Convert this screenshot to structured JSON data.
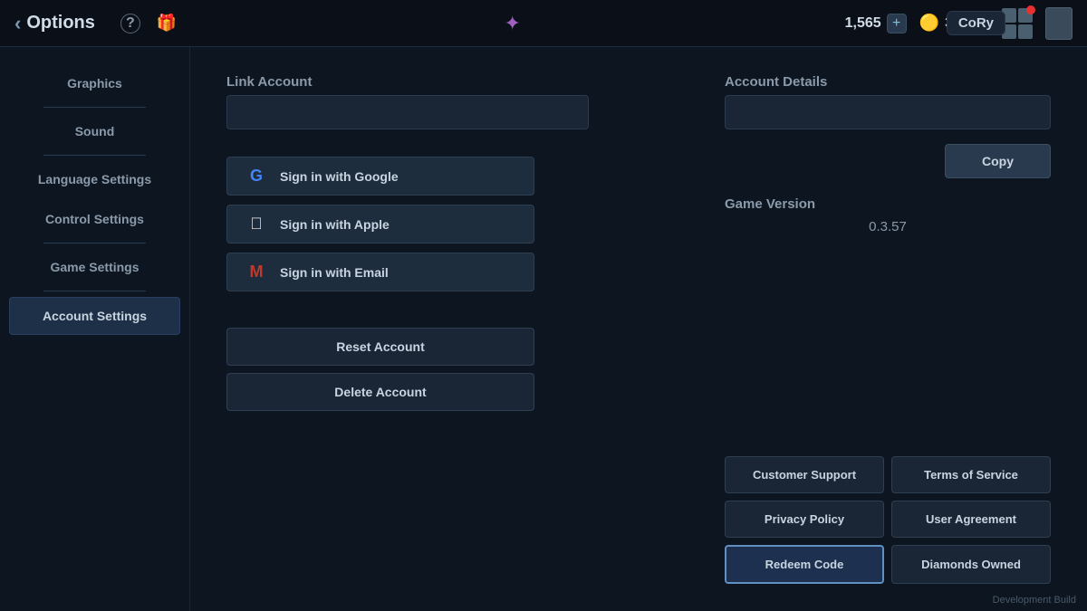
{
  "topbar": {
    "back_label": "Options",
    "help_icon": "?",
    "gift_icon": "🎁",
    "nav_icon": "✦",
    "currency1_value": "1,565",
    "currency1_plus": "+",
    "currency2_icon": "🟡",
    "currency2_value": "38,099",
    "user_name": "CoRy"
  },
  "sidebar": {
    "items": [
      {
        "label": "Graphics",
        "active": false
      },
      {
        "label": "Sound",
        "active": false
      },
      {
        "label": "Language Settings",
        "active": false
      },
      {
        "label": "Control Settings",
        "active": false
      },
      {
        "label": "Game Settings",
        "active": false
      },
      {
        "label": "Account Settings",
        "active": true
      }
    ]
  },
  "left_panel": {
    "link_account_title": "Link Account",
    "signin_google": "Sign in with Google",
    "signin_apple": "Sign in with Apple",
    "signin_email": "Sign in with Email",
    "reset_account": "Reset Account",
    "delete_account": "Delete Account"
  },
  "right_panel": {
    "account_details_title": "Account Details",
    "copy_label": "Copy",
    "game_version_title": "Game Version",
    "version_value": "0.3.57",
    "customer_support": "Customer Support",
    "terms_of_service": "Terms of Service",
    "privacy_policy": "Privacy Policy",
    "user_agreement": "User Agreement",
    "redeem_code": "Redeem Code",
    "diamonds_owned": "Diamonds Owned"
  },
  "dev_build": "Development Build"
}
